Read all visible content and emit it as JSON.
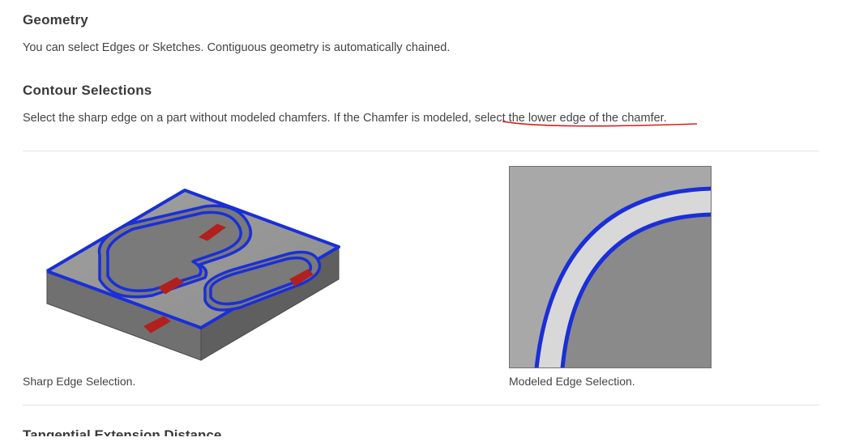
{
  "sections": {
    "geometry": {
      "title": "Geometry",
      "desc": "You can select Edges or Sketches. Contiguous geometry is automatically chained."
    },
    "contour": {
      "title": "Contour Selections",
      "desc_a": "Select the sharp edge on a part without modeled chamfers. If the Chamfer is modeled, selec",
      "desc_b": "t the lower edge of the chamfer."
    },
    "tangential": {
      "title": "Tangential Extension Distance"
    }
  },
  "figures": {
    "left_caption": "Sharp Edge Selection.",
    "right_caption": "Modeled Edge Selection."
  }
}
